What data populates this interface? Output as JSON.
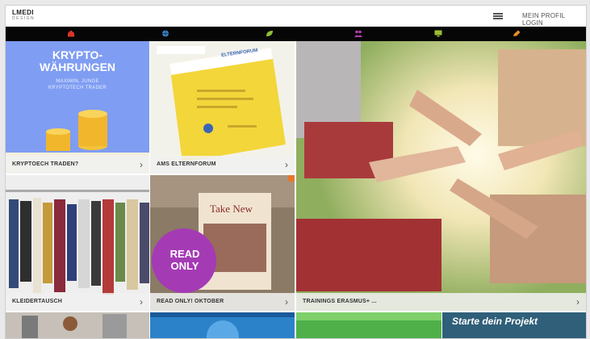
{
  "header": {
    "logo_line1": "LMEDI",
    "logo_line2": "DESIGN",
    "login_label": "MEIN PROFIL LOGIN"
  },
  "categories": [
    {
      "icon": "home-icon",
      "color": "#d9362a"
    },
    {
      "icon": "globe-icon",
      "color": "#3c82c4"
    },
    {
      "icon": "leaf-icon",
      "color": "#8fbf3a"
    },
    {
      "icon": "people-icon",
      "color": "#b23fa8"
    },
    {
      "icon": "monitor-icon",
      "color": "#9bbd2f"
    },
    {
      "icon": "pencil-icon",
      "color": "#e8902c"
    }
  ],
  "tiles": [
    {
      "headline": "KRYPTO-\nWÄHRUNGEN",
      "subline": "MAXIMIN, JUNGE\nKRYPTOTECH TRADER",
      "caption": "KRYPTOECH TRADEN?"
    },
    {
      "poster_title": "ELTERNFORUM",
      "caption": "AMS ELTERNFORUM"
    },
    {
      "caption": "TRAININGS ERASMUS+ ..."
    },
    {
      "caption": "KLEIDERTAUSCH"
    },
    {
      "book_title": "Take New",
      "badge_line1": "READ",
      "badge_line2": "ONLY",
      "caption": "READ ONLY! OKTOBER"
    },
    {
      "headline": "Starte dein Projekt"
    }
  ]
}
